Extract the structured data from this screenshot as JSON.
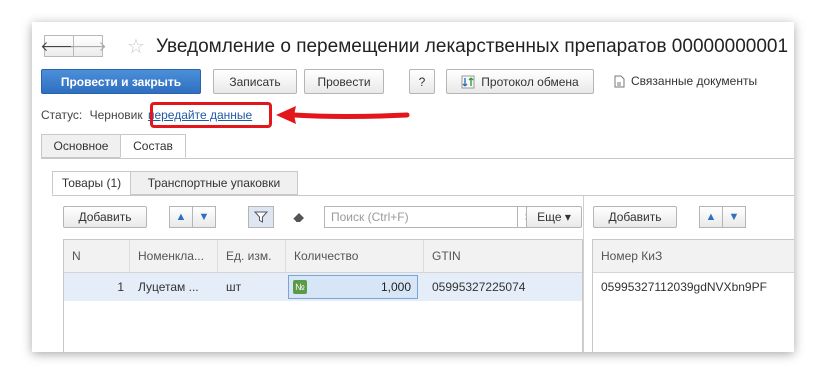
{
  "nav": {
    "back_icon": "arrow-left-icon",
    "forward_icon": "arrow-right-icon",
    "back_glyph": "🡐",
    "forward_glyph": "🡒",
    "star_glyph": "☆"
  },
  "window": {
    "title": "Уведомление о перемещении лекарственных препаратов 00000000001"
  },
  "toolbar": {
    "post_close_label": "Провести и закрыть",
    "save_label": "Записать",
    "post_label": "Провести",
    "help_label": "?",
    "exchange_label": "Протокол обмена",
    "related_label": "Связанные документы"
  },
  "status": {
    "prefix": "Статус:",
    "value": "Черновик",
    "link": "передайте данные"
  },
  "tabs": [
    {
      "label": "Основное"
    },
    {
      "label": "Состав"
    }
  ],
  "subtabs": [
    {
      "label": "Товары (1)"
    },
    {
      "label": "Транспортные упаковки"
    }
  ],
  "left_panel": {
    "add_label": "Добавить",
    "search_placeholder": "Поиск (Ctrl+F)",
    "clear_glyph": "×",
    "more_label": "Еще ▾",
    "columns": [
      "N",
      "Номенкла...",
      "Ед. изм.",
      "Количество",
      "GTIN"
    ],
    "rows": [
      {
        "n": "1",
        "nomenclature": "Луцетам ...",
        "unit": "шт",
        "qty": "1,000",
        "gtin": "05995327225074",
        "qty_icon": "№"
      }
    ]
  },
  "right_panel": {
    "add_label": "Добавить",
    "columns": [
      "Номер КиЗ"
    ],
    "rows": [
      {
        "kiz": "05995327112039gdNVXbn9PF"
      }
    ]
  },
  "colors": {
    "accent": "#2f6fc0",
    "highlight": "#e3161b",
    "selected_row": "#e5edf8"
  }
}
